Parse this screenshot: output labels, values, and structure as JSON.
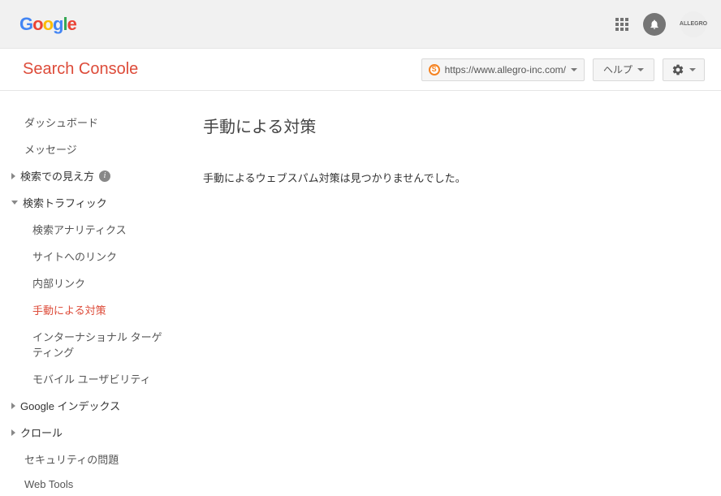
{
  "header": {
    "avatar_label": "ALLEGRO"
  },
  "subheader": {
    "product_name": "Search Console",
    "site_url": "https://www.allegro-inc.com/",
    "help_label": "ヘルプ"
  },
  "sidebar": {
    "dashboard": "ダッシュボード",
    "messages": "メッセージ",
    "appearance": "検索での見え方",
    "traffic": {
      "label": "検索トラフィック",
      "analytics": "検索アナリティクス",
      "links_to_site": "サイトへのリンク",
      "internal_links": "内部リンク",
      "manual_actions": "手動による対策",
      "intl_targeting": "インターナショナル ターゲティング",
      "mobile_usability": "モバイル ユーザビリティ"
    },
    "google_index": "Google インデックス",
    "crawl": "クロール",
    "security": "セキュリティの問題",
    "web_tools": "Web Tools"
  },
  "content": {
    "title": "手動による対策",
    "message": "手動によるウェブスパム対策は見つかりませんでした。"
  }
}
